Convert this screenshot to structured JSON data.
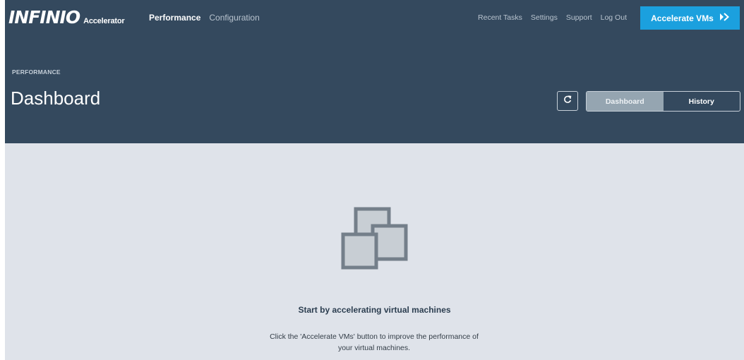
{
  "brand": {
    "logo_text": "INFINIO",
    "logo_sub": "Accelerator"
  },
  "nav": {
    "items": [
      {
        "label": "Performance",
        "active": true
      },
      {
        "label": "Configuration",
        "active": false
      }
    ]
  },
  "utility_links": [
    "Recent Tasks",
    "Settings",
    "Support",
    "Log Out"
  ],
  "accelerate_button": {
    "label": "Accelerate VMs",
    "icon": "double-chevron-right-icon"
  },
  "header": {
    "breadcrumb": "PERFORMANCE",
    "title": "Dashboard",
    "refresh_icon": "refresh-icon",
    "view_toggle": [
      {
        "label": "Dashboard",
        "active": true
      },
      {
        "label": "History",
        "active": false
      }
    ]
  },
  "empty_state": {
    "icon": "virtual-machines-icon",
    "title": "Start by accelerating virtual machines",
    "description": "Click the 'Accelerate VMs' button to improve the performance of your virtual machines."
  },
  "colors": {
    "header_bg": "#34495e",
    "accent": "#1ba0de",
    "content_bg": "#dfe3ea",
    "active_segment": "#95a5b1"
  }
}
